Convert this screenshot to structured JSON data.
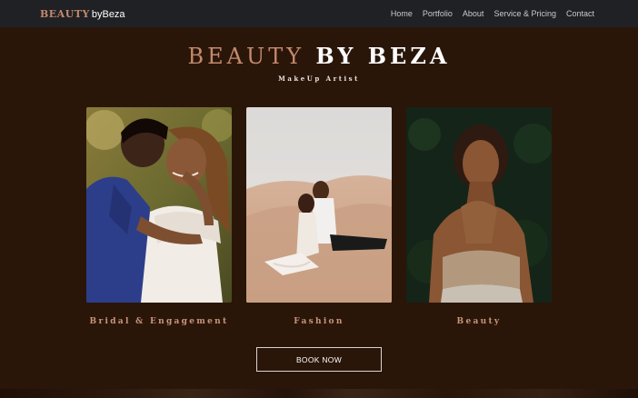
{
  "navbar": {
    "brand_part1": "BEAUTY",
    "brand_part2": "byBeza",
    "links": [
      "Home",
      "Portfolio",
      "About",
      "Service & Pricing",
      "Contact"
    ]
  },
  "hero": {
    "title_part1": "BEAUTY",
    "title_part2": "BY BEZA",
    "subtitle": "MakeUp Artist"
  },
  "cards": [
    {
      "label": "Bridal & Engagement"
    },
    {
      "label": "Fashion"
    },
    {
      "label": "Beauty"
    }
  ],
  "cta": {
    "label": "BOOK NOW"
  },
  "colors": {
    "accent": "#c4896e",
    "background": "#2a1609",
    "navbar": "#202124"
  }
}
